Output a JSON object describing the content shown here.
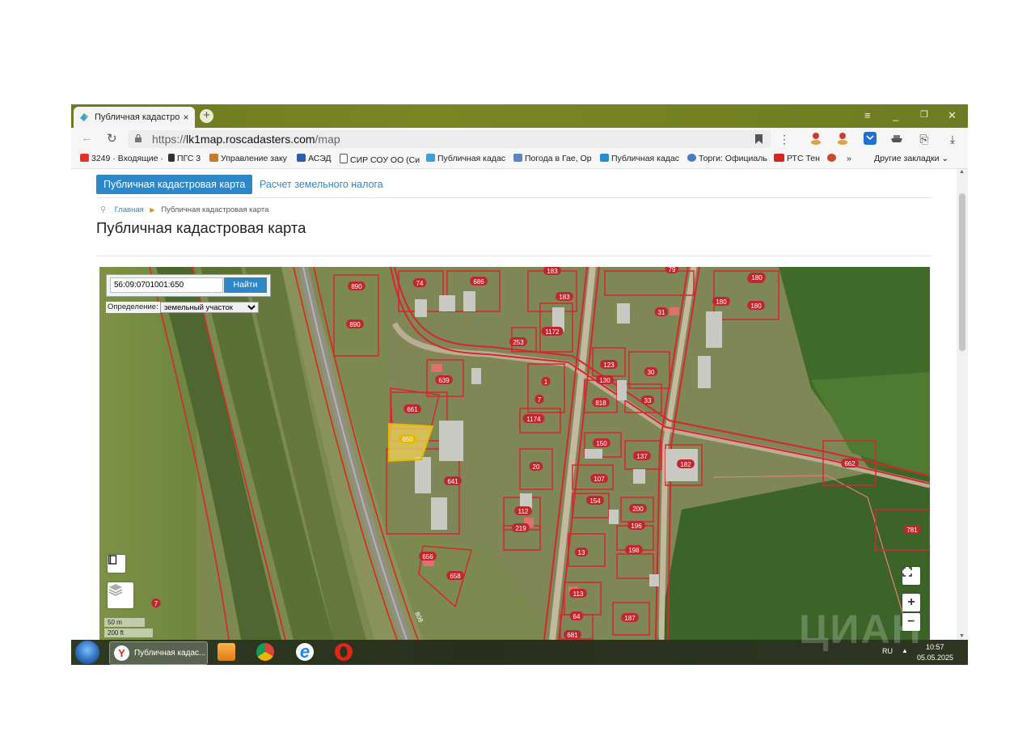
{
  "browser": {
    "tab_title": "Публичная кадастрова",
    "tab_close": "×",
    "new_tab": "+",
    "window_controls": [
      "≡",
      "_",
      "❐",
      "✕"
    ],
    "url_protocol": "https://",
    "url_host": "lk1map.roscadasters.com",
    "url_path": "/map",
    "bookmarks": [
      "3249 · Входящие ·",
      "ПГС 3",
      "Управление заку",
      "АСЭД",
      "СИР СОУ ОО (Си",
      "Публичная кадас",
      "Погода в Гае, Ор",
      "Публичная кадас",
      "Торги: Официаль",
      "РТС Тен"
    ],
    "bookmarks_more": "»",
    "other_bookmarks": "Другие закладки"
  },
  "page": {
    "nav_tabs": [
      "Публичная кадастровая карта",
      "Расчет земельного налога"
    ],
    "breadcrumb_home": "Главная",
    "breadcrumb_current": "Публичная кадастровая карта",
    "title": "Публичная кадастровая карта"
  },
  "map": {
    "search_value": "56:09:0701001:650",
    "search_button": "Найти",
    "definition_label": "Определение:",
    "definition_value": "земельный участок",
    "scale_m": "50 m",
    "scale_ft": "200 ft",
    "zoom_in": "+",
    "zoom_out": "−",
    "parcel_labels": [
      "890",
      "890",
      "74",
      "686",
      "183",
      "79",
      "180",
      "180",
      "180",
      "180",
      "183",
      "31",
      "1172",
      "253",
      "639",
      "123",
      "130",
      "30",
      "1",
      "7",
      "818",
      "33",
      "661",
      "1174",
      "650",
      "150",
      "137",
      "182",
      "20",
      "662",
      "107",
      "641",
      "154",
      "112",
      "200",
      "196",
      "219",
      "198",
      "13",
      "656",
      "658",
      "113",
      "64",
      "187",
      "681",
      "781",
      "7"
    ],
    "road_label": "808"
  },
  "taskbar": {
    "task_title": "Публичная кадас...",
    "lang": "RU",
    "time": "10:57",
    "date": "05.05.2025"
  },
  "watermark": "ЦИАН"
}
